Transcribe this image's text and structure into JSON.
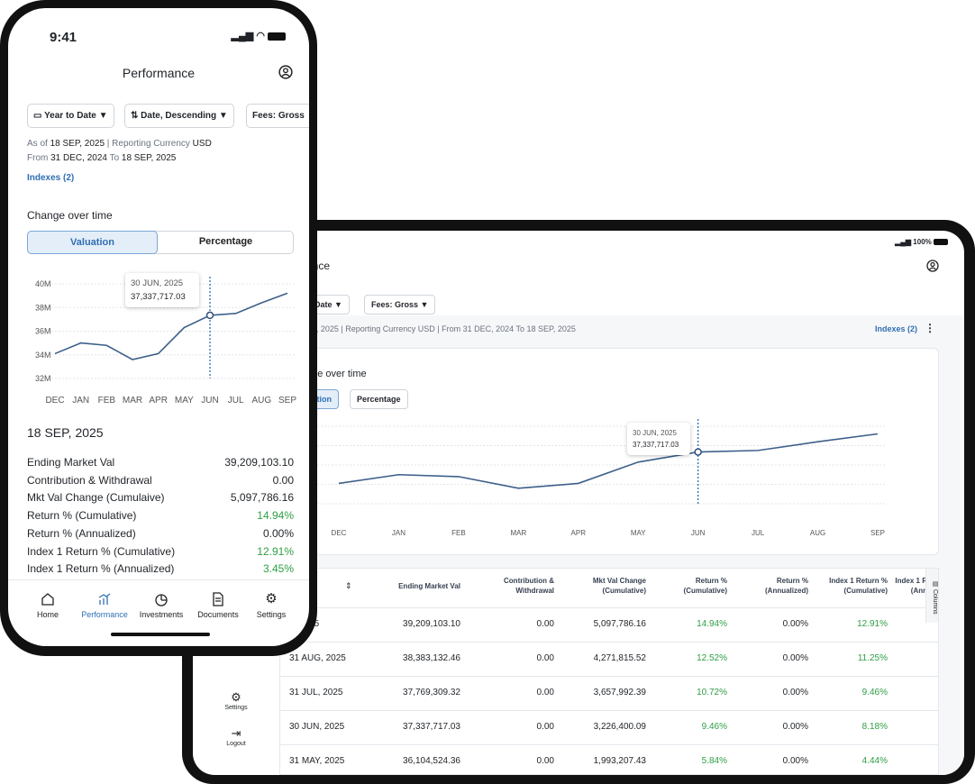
{
  "phone": {
    "status_time": "9:41",
    "title": "Performance",
    "filters": {
      "period": "Year to Date ▼",
      "sort": "Date, Descending ▼",
      "fees": "Fees: Gross"
    },
    "as_of_label": "As of",
    "as_of_date": "18 SEP, 2025",
    "reporting_label": "Reporting Currency",
    "currency": "USD",
    "from_label": "From",
    "from_date": "31 DEC, 2024",
    "to_label": "To",
    "to_date": "18 SEP, 2025",
    "indexes_link": "Indexes (2)",
    "section_title": "Change over time",
    "toggle": {
      "valuation": "Valuation",
      "percentage": "Percentage"
    },
    "tooltip": {
      "date": "30 JUN, 2025",
      "value": "37,337,717.03"
    },
    "summary_date": "18 SEP, 2025",
    "summary": [
      {
        "label": "Ending Market Val",
        "value": "39,209,103.10"
      },
      {
        "label": "Contribution & Withdrawal",
        "value": "0.00"
      },
      {
        "label": "Mkt Val Change (Cumulaive)",
        "value": "5,097,786.16"
      },
      {
        "label": "Return % (Cumulative)",
        "value": "14.94%"
      },
      {
        "label": "Return % (Annualized)",
        "value": "0.00%"
      },
      {
        "label": "Index 1 Return % (Cumulative)",
        "value": "12.91%"
      },
      {
        "label": "Index 1 Return % (Annualized)",
        "value": "3.45%"
      }
    ],
    "nav": [
      "Home",
      "Performance",
      "Investments",
      "Documents",
      "Settings"
    ]
  },
  "tablet": {
    "status_battery": "100%",
    "title_partial": "ance",
    "filters": {
      "period": "o Date ▼",
      "fees": "Fees: Gross ▼"
    },
    "info_line": "EP, 2025 | Reporting Currency USD | From 31 DEC, 2024 To 18 SEP, 2025",
    "indexes_link": "Indexes (2)",
    "section_title": "nge over time",
    "toggle": {
      "valuation": "uation",
      "percentage": "Percentage"
    },
    "tooltip": {
      "date": "30 JUN, 2025",
      "value": "37,337,717.03"
    },
    "sidebar": {
      "settings": "Settings",
      "logout": "Logout"
    },
    "table": {
      "columns_label": "Columns",
      "headers": [
        "on",
        "Ending Market Val",
        "Contribution & Withdrawal",
        "Mkt Val Change (Cumulative)",
        "Return % (Cumulative)",
        "Return % (Annualized)",
        "Index 1 Return % (Cumulative)",
        "Index 1 R (Ann"
      ],
      "rows": [
        [
          "P, 2025",
          "39,209,103.10",
          "0.00",
          "5,097,786.16",
          "14.94%",
          "0.00%",
          "12.91%"
        ],
        [
          "31 AUG, 2025",
          "38,383,132.46",
          "0.00",
          "4,271,815.52",
          "12.52%",
          "0.00%",
          "11.25%"
        ],
        [
          "31 JUL, 2025",
          "37,769,309.32",
          "0.00",
          "3,657,992.39",
          "10.72%",
          "0.00%",
          "9.46%"
        ],
        [
          "30 JUN, 2025",
          "37,337,717.03",
          "0.00",
          "3,226,400.09",
          "9.46%",
          "0.00%",
          "8.18%"
        ],
        [
          "31 MAY, 2025",
          "36,104,524.36",
          "0.00",
          "1,993,207.43",
          "5.84%",
          "0.00%",
          "4.44%"
        ]
      ]
    }
  },
  "chart_data": [
    {
      "type": "line",
      "categories": [
        "DEC",
        "JAN",
        "FEB",
        "MAR",
        "APR",
        "MAY",
        "JUN",
        "JUL",
        "AUG",
        "SEP"
      ],
      "values": [
        34.1,
        35.0,
        34.8,
        33.6,
        34.1,
        36.3,
        37.34,
        37.5,
        38.4,
        39.21
      ],
      "ylim": [
        32,
        40
      ],
      "ytick_labels": [
        "40M",
        "38M",
        "36M",
        "34M",
        "32M"
      ],
      "highlight_category": "JUN",
      "grid": true
    },
    {
      "type": "line",
      "categories": [
        "DEC",
        "JAN",
        "FEB",
        "MAR",
        "APR",
        "MAY",
        "JUN",
        "JUL",
        "AUG",
        "SEP"
      ],
      "values": [
        34.1,
        35.0,
        34.8,
        33.6,
        34.1,
        36.3,
        37.34,
        37.5,
        38.4,
        39.21
      ],
      "ylim": [
        32,
        40
      ],
      "highlight_category": "JUN",
      "grid": true
    }
  ],
  "colors": {
    "accent": "#2f6fb3",
    "line": "#3d5f8a",
    "positive": "#2f9e44",
    "toggle_bg": "#e4eef9"
  }
}
